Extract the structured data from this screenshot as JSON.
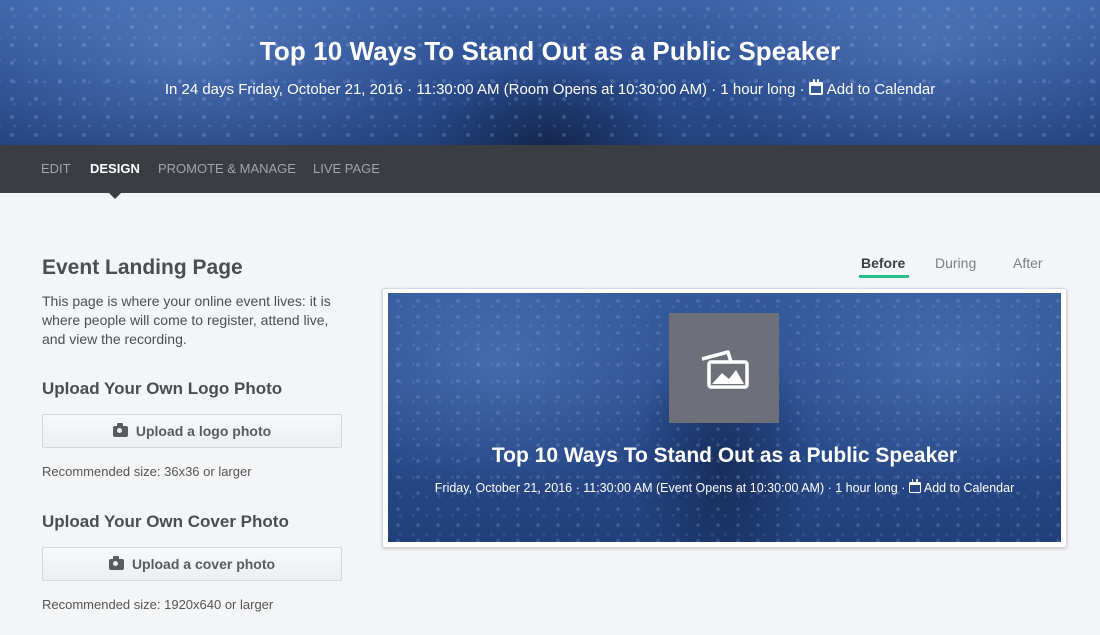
{
  "event": {
    "title": "Top 10 Ways To Stand Out as a Public Speaker",
    "meta": "In 24 days Friday, October 21, 2016 · 11:30:00 AM (Room Opens at 10:30:00 AM) · 1 hour long ·",
    "add_to_calendar": "Add to Calendar"
  },
  "nav": {
    "tabs": [
      {
        "label": "EDIT"
      },
      {
        "label": "DESIGN",
        "active": true
      },
      {
        "label": "PROMOTE & MANAGE"
      },
      {
        "label": "LIVE PAGE"
      }
    ]
  },
  "landing": {
    "title": "Event Landing Page",
    "description": "This page is where your online event lives: it is where people will come to register, attend live, and view the recording."
  },
  "logo_upload": {
    "title": "Upload Your Own Logo Photo",
    "button": "Upload a logo photo",
    "hint": "Recommended size: 36x36 or larger"
  },
  "cover_upload": {
    "title": "Upload Your Own Cover Photo",
    "button": "Upload a cover photo",
    "hint": "Recommended size: 1920x640 or larger"
  },
  "phases": {
    "tabs": [
      {
        "label": "Before",
        "active": true
      },
      {
        "label": "During"
      },
      {
        "label": "After"
      }
    ],
    "accent_color": "#26bd8a"
  },
  "preview": {
    "title": "Top 10 Ways To Stand Out as a Public Speaker",
    "meta": "Friday, October 21, 2016 · 11:30:00 AM (Event Opens at 10:30:00 AM) · 1 hour long ·",
    "add_to_calendar": "Add to Calendar",
    "logo_placeholder_icon": "image-placeholder-icon"
  },
  "colors": {
    "nav_bg": "#3a3d42",
    "page_bg": "#f4f5f7",
    "hero_blue": "#2c4f91"
  }
}
